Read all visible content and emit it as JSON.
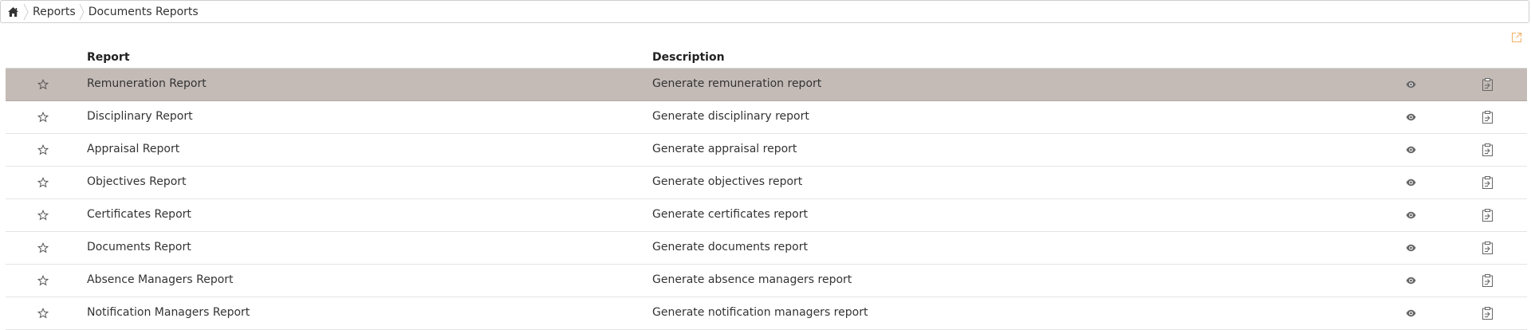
{
  "breadcrumb": {
    "home_icon": "home-icon",
    "items": [
      "Reports",
      "Documents Reports"
    ]
  },
  "toolbar": {
    "export_icon": "export-icon",
    "accent_color": "#f0b062"
  },
  "table": {
    "headers": {
      "report": "Report",
      "description": "Description"
    },
    "selected_row_color": "#c4bbb7",
    "rows": [
      {
        "name": "Remuneration Report",
        "description": "Generate remuneration report",
        "selected": true
      },
      {
        "name": "Disciplinary Report",
        "description": "Generate disciplinary report",
        "selected": false
      },
      {
        "name": "Appraisal Report",
        "description": "Generate appraisal report",
        "selected": false
      },
      {
        "name": "Objectives Report",
        "description": "Generate objectives report",
        "selected": false
      },
      {
        "name": "Certificates Report",
        "description": "Generate certificates report",
        "selected": false
      },
      {
        "name": "Documents Report",
        "description": "Generate documents report",
        "selected": false
      },
      {
        "name": "Absence Managers Report",
        "description": "Generate absence managers report",
        "selected": false
      },
      {
        "name": "Notification Managers Report",
        "description": "Generate notification managers report",
        "selected": false
      }
    ],
    "row_icons": [
      "star-icon",
      "eye-icon",
      "generate-report-icon"
    ]
  }
}
